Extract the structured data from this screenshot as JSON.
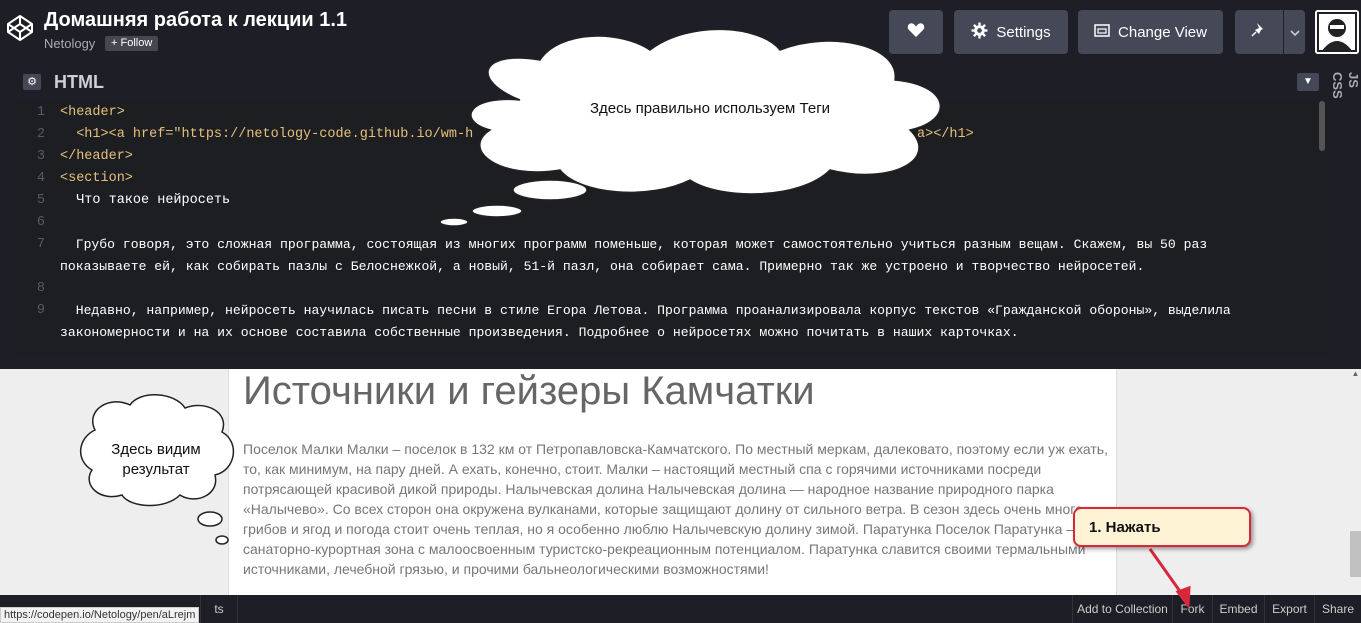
{
  "header": {
    "title": "Домашняя работа к лекции 1.1",
    "author": "Netology",
    "follow_label": "+ Follow",
    "settings_label": "Settings",
    "change_view_label": "Change View"
  },
  "editor": {
    "title": "HTML",
    "right_tabs": [
      "CSS",
      "JS"
    ],
    "lines": [
      {
        "n": "1",
        "text": "<header>"
      },
      {
        "n": "2",
        "text": "  <h1><a href=\"https://netology-code.github.io/wm-h"
      },
      {
        "n": "",
        "text": "a></h1>"
      },
      {
        "n": "3",
        "text": "</header>"
      },
      {
        "n": "4",
        "text": "<section>"
      },
      {
        "n": "5",
        "text": "  Что такое нейросеть"
      },
      {
        "n": "6",
        "text": ""
      },
      {
        "n": "7",
        "text": "  Грубо говоря, это сложная программа, состоящая из многих программ поменьше, которая может самостоятельно учиться разным вещам. Скажем, вы 50 раз"
      },
      {
        "n": "",
        "text": "показываете ей, как собирать пазлы с Белоснежкой, а новый, 51-й пазл, она собирает сама. Примерно так же устроено и творчество нейросетей."
      },
      {
        "n": "8",
        "text": ""
      },
      {
        "n": "9",
        "text": "  Недавно, например, нейросеть научилась писать песни в стиле Егора Летова. Программа проанализировала корпус текстов «Гражданской обороны», выделила"
      },
      {
        "n": "",
        "text": "закономерности и на их основе составила собственные произведения. Подробнее о нейросетях можно почитать в наших карточках."
      }
    ]
  },
  "preview": {
    "heading": "Источники и гейзеры Камчатки",
    "paragraph": "Поселок Малки Малки – поселок в 132 км от Петропавловска-Камчатского. По местный меркам, далековато, поэтому если уж ехать, то, как минимум, на пару дней. А ехать, конечно, стоит. Малки – настоящий местный спа с горячими источниками посреди потрясающей красивой дикой природы. Налычевская долина Налычевская долина — народное название природного парка «Налычево». Со всех сторон она окружена вулканами, которые защищают долину от сильного ветра. В сезон здесь очень много грибов и ягод и погода стоит очень теплая, но я особенно люблю Налычевскую долину зимой. Паратунка Поселок Паратунка – санаторно-курортная зона с малоосвоенным туристско-рекреационным потенциалом. Паратунка славится своими термальными источниками, лечебной грязью, и прочими бальнеологическими возможностями!"
  },
  "footer": {
    "status_url": "https://codepen.io/Netology/pen/aLrejm",
    "partial_label": "ts",
    "buttons": [
      "Add to Collection",
      "Fork",
      "Embed",
      "Export",
      "Share"
    ]
  },
  "annotations": {
    "cloud_top": "Здесь правильно используем Теги",
    "cloud_left": "Здесь видим результат",
    "note": "1. Нажать"
  },
  "colors": {
    "accent_red": "#d6283a",
    "note_bg": "#fff3d6"
  }
}
